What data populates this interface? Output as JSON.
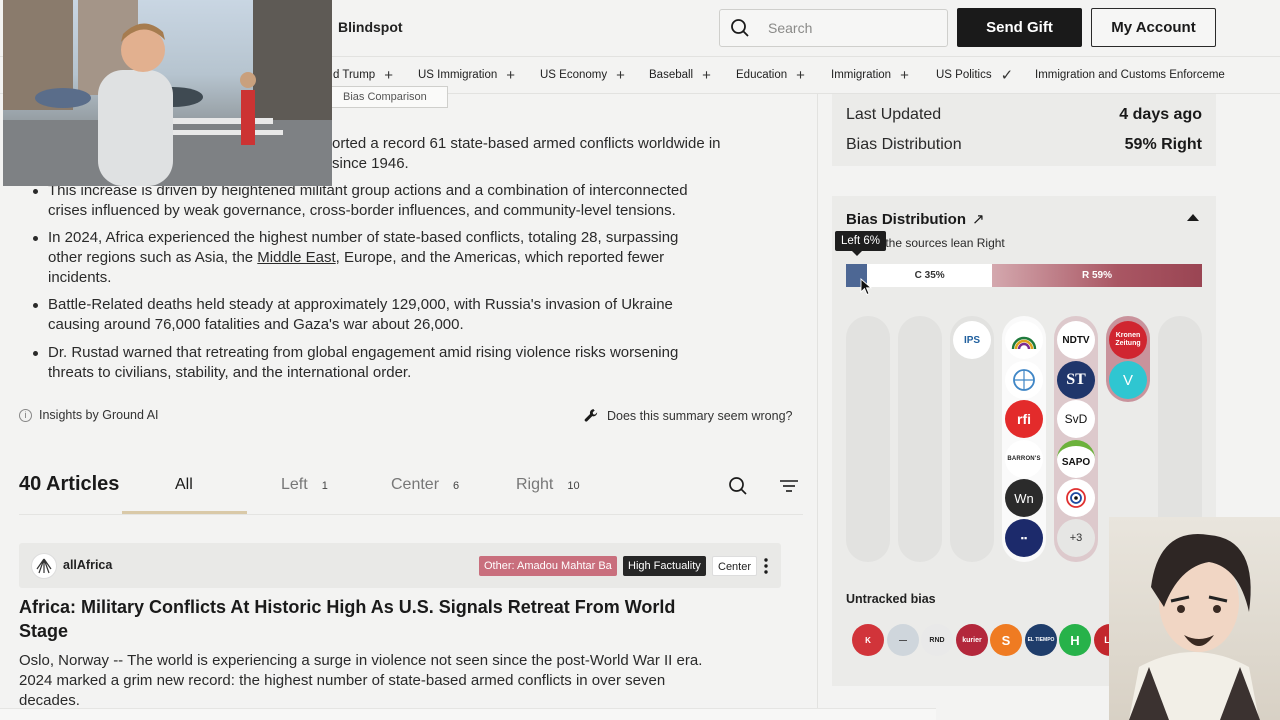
{
  "header": {
    "nav_blindspot": "Blindspot",
    "search_placeholder": "Search",
    "send_gift": "Send Gift",
    "my_account": "My Account"
  },
  "topics": [
    {
      "label": "d Trump",
      "mark": "+"
    },
    {
      "label": "US Immigration",
      "mark": "+"
    },
    {
      "label": "US Economy",
      "mark": "+"
    },
    {
      "label": "Baseball",
      "mark": "+"
    },
    {
      "label": "Education",
      "mark": "+"
    },
    {
      "label": "Immigration",
      "mark": "+"
    },
    {
      "label": "US Politics",
      "mark": "✓"
    },
    {
      "label": "Immigration and Customs Enforceme",
      "mark": ""
    }
  ],
  "summary": {
    "bias_comparison": "Bias Comparison",
    "line0a": "orted a record 61 state-based armed conflicts worldwide in",
    "line0b": "since 1946.",
    "b1a": "This increase is driven by heightened militant group actions and a combination of interconnected",
    "b1b": "crises influenced by weak governance, cross-border influences, and community-level tensions.",
    "b2a": "In 2024, Africa experienced the highest number of state-based conflicts, totaling 28, surpassing",
    "b2b_pre": "other regions such as Asia, the ",
    "b2b_link": "Middle East",
    "b2b_post": ", Europe, and the Americas, which reported fewer",
    "b2c": "incidents.",
    "b3a": "Battle-Related deaths held steady at approximately 129,000, with Russia's invasion of Ukraine",
    "b3b": "causing around 76,000 fatalities and Gaza's war about 26,000.",
    "b4a": "Dr. Rustad warned that retreating from global engagement amid rising violence risks worsening",
    "b4b": "threats to civilians, stability, and the international order.",
    "insights": "Insights by Ground AI",
    "wrong": "Does this summary seem wrong?"
  },
  "articles": {
    "title": "40 Articles",
    "tabs": [
      {
        "label": "All",
        "count": ""
      },
      {
        "label": "Left",
        "count": "1"
      },
      {
        "label": "Center",
        "count": "6"
      },
      {
        "label": "Right",
        "count": "10"
      }
    ],
    "item": {
      "source": "allAfrica",
      "badge_other": "Other: Amadou Mahtar Ba",
      "badge_factuality": "High Factuality",
      "badge_bias": "Center",
      "title1": "Africa: Military Conflicts At Historic High As U.S. Signals Retreat From World",
      "title2": "Stage",
      "body1": "Oslo, Norway -- The world is experiencing a surge in violence not seen since the post-World War II era.",
      "body2": "2024 marked a grim new record: the highest number of state-based armed conflicts in over seven",
      "body3": "decades."
    }
  },
  "info": {
    "last_updated_label": "Last Updated",
    "last_updated_value": "4 days ago",
    "bias_dist_label": "Bias Distribution",
    "bias_dist_value": "59% Right"
  },
  "distribution": {
    "title": "Bias Distribution",
    "arrow": "↗",
    "subtitle": "of the sources lean Right",
    "tooltip": "Left 6%",
    "left_pct": 6,
    "center_pct": 35,
    "right_pct": 59,
    "center_label": "C 35%",
    "right_label": "R 59%",
    "icons": {
      "ips": "IPS",
      "ndtv": "NDTV",
      "st": "ST",
      "svd": "SvD",
      "sapo": "SAPO",
      "barrons": "BARRON'S",
      "wn": "Wn",
      "more": "+3",
      "kronen": "Kronen Zeitung",
      "v": "V"
    },
    "untracked_label": "Untracked bias",
    "untracked": [
      {
        "text": "K",
        "color": "#d1343a"
      },
      {
        "text": "—",
        "color": "#cfd6dc"
      },
      {
        "text": "RND",
        "color": "#e9e9e9"
      },
      {
        "text": "kurier",
        "color": "#b3273b"
      },
      {
        "text": "S",
        "color": "#ef7b22"
      },
      {
        "text": "EL TIEMPO",
        "color": "#1f3d6b"
      },
      {
        "text": "H",
        "color": "#27b24a"
      },
      {
        "text": "LE",
        "color": "#c2272d"
      }
    ]
  }
}
